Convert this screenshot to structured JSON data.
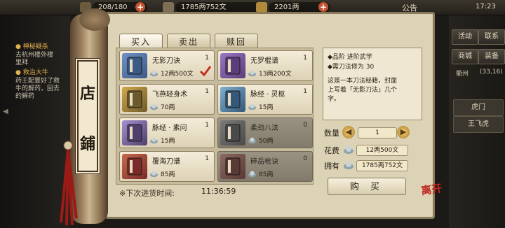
{
  "top_bar": {
    "resource1": "208/180",
    "resource2": "1785两752文",
    "resource3": "2201两",
    "notice": "公告",
    "time": "17:23"
  },
  "quests": {
    "q1_title": "● 神秘疑杀",
    "q1_l1": "去杭州楼外楼",
    "q1_l2": "里拜",
    "q2_title": "● 救治大牛",
    "q2_l1": "药王配置好了救",
    "q2_l2": "牛的解药，回去",
    "q2_l3": "的解药"
  },
  "right_panel": {
    "btn1": "活动",
    "btn2": "联系",
    "btn3": "商城",
    "btn4": "装备",
    "loc1": "衢州",
    "loc2": "(33,16)",
    "list1": "虎门",
    "list2": "王飞虎"
  },
  "shop": {
    "sign_top": "店",
    "sign_bottom": "鋪",
    "tabs": [
      "买入",
      "卖出",
      "赎回"
    ],
    "items": [
      {
        "name": "无影刀诀",
        "qty": "1",
        "price": "12两500文",
        "icon": "book-blue-icon",
        "selected": true,
        "dim": false
      },
      {
        "name": "无罗棍谱",
        "qty": "1",
        "price": "13两200文",
        "icon": "book-purple-icon",
        "selected": false,
        "dim": false
      },
      {
        "name": "飞燕轻身术",
        "qty": "1",
        "price": "70两",
        "icon": "scroll-gold-icon",
        "selected": false,
        "dim": false
      },
      {
        "name": "脉经 · 灵枢",
        "qty": "1",
        "price": "15两",
        "icon": "scroll-blue-icon",
        "selected": false,
        "dim": false
      },
      {
        "name": "脉经 · 素问",
        "qty": "1",
        "price": "15两",
        "icon": "scroll-purple-icon",
        "selected": false,
        "dim": false
      },
      {
        "name": "柔劲八法",
        "qty": "0",
        "price": "50两",
        "icon": "book-gray-icon",
        "selected": false,
        "dim": true
      },
      {
        "name": "覆海刀谱",
        "qty": "1",
        "price": "85两",
        "icon": "book-red-icon",
        "selected": false,
        "dim": false
      },
      {
        "name": "碎岳枪诀",
        "qty": "0",
        "price": "85两",
        "icon": "book-red-gray-icon",
        "selected": false,
        "dim": true
      }
    ],
    "restock_label": "※下次进货时间:",
    "restock_time": "11:36:59",
    "detail": {
      "line1": "◆品阶 进阶武学",
      "line2": "◆需刀法修为 30",
      "desc1": "这是一本刀法秘籍，封面",
      "desc2": "上写着「无影刀法」几个",
      "desc3": "字。"
    },
    "qty_label": "数量",
    "qty_value": "1",
    "cost_label": "花费",
    "cost_value": "12两500文",
    "own_label": "拥有",
    "own_value": "1785两752文",
    "buy_label": "购 买",
    "close_seal": "离开"
  }
}
